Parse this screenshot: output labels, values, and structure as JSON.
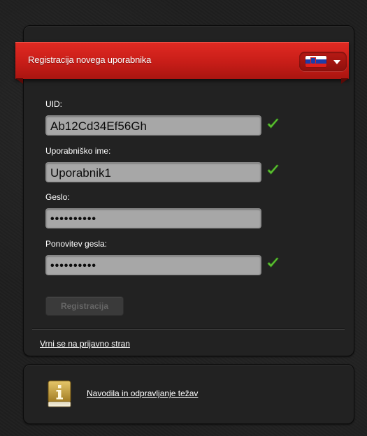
{
  "header": {
    "title": "Registracija novega uporabnika",
    "language": "Slovenian",
    "flag_icon": "slovenia-flag-icon"
  },
  "form": {
    "uid": {
      "label": "UID:",
      "value": "Ab12Cd34Ef56Gh",
      "valid": true
    },
    "username": {
      "label": "Uporabniško ime:",
      "value": "Uporabnik1",
      "valid": true
    },
    "password": {
      "label": "Geslo:",
      "value": "••••••••••",
      "valid": false
    },
    "password_repeat": {
      "label": "Ponovitev gesla:",
      "value": "••••••••••",
      "valid": true
    },
    "submit_label": "Registracija",
    "submit_enabled": false
  },
  "back_link": "Vrni se na prijavno stran",
  "help": {
    "link": "Navodila in odpravljanje težav",
    "icon": "info-book-icon"
  },
  "colors": {
    "accent_red": "#d4231c",
    "check_green": "#5fc234",
    "field_bg": "#a7a7a7",
    "panel_bg": "#222222"
  }
}
